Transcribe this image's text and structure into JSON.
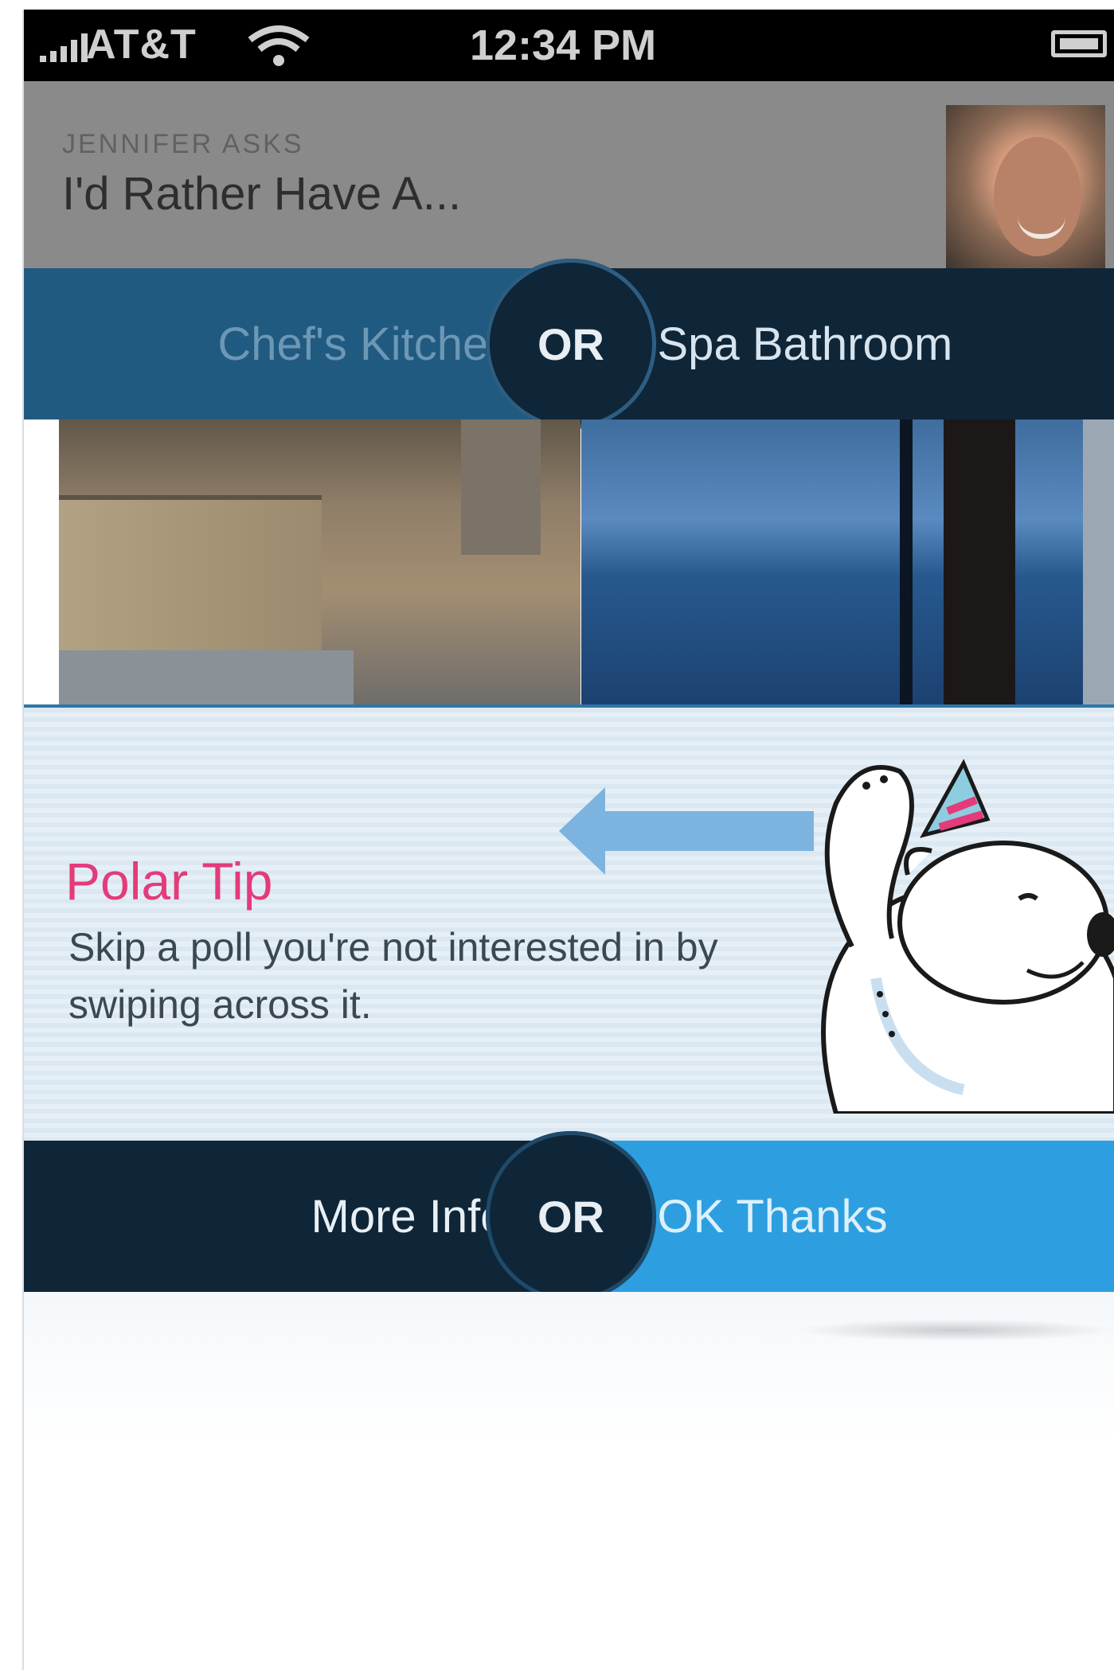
{
  "status_bar": {
    "carrier": "AT&T",
    "time": "12:34 PM",
    "icons": [
      "signal-icon",
      "wifi-icon",
      "battery-icon"
    ]
  },
  "question": {
    "asker": "JENNIFER ASKS",
    "text": "I'd Rather Have A..."
  },
  "poll": {
    "option_a": "Chef's Kitchen",
    "option_b": "Spa Bathroom",
    "separator": "OR"
  },
  "tip": {
    "title": "Polar Tip",
    "body": "Skip a poll you're not interested in by swiping across it."
  },
  "actions": {
    "more_info": "More Info",
    "separator": "OR",
    "ok_thanks": "OK Thanks"
  },
  "colors": {
    "tip_title": "#e43b7a",
    "band_dark": "#0f2638",
    "band_blue": "#215a80",
    "ok_blue": "#2d9fe0"
  }
}
